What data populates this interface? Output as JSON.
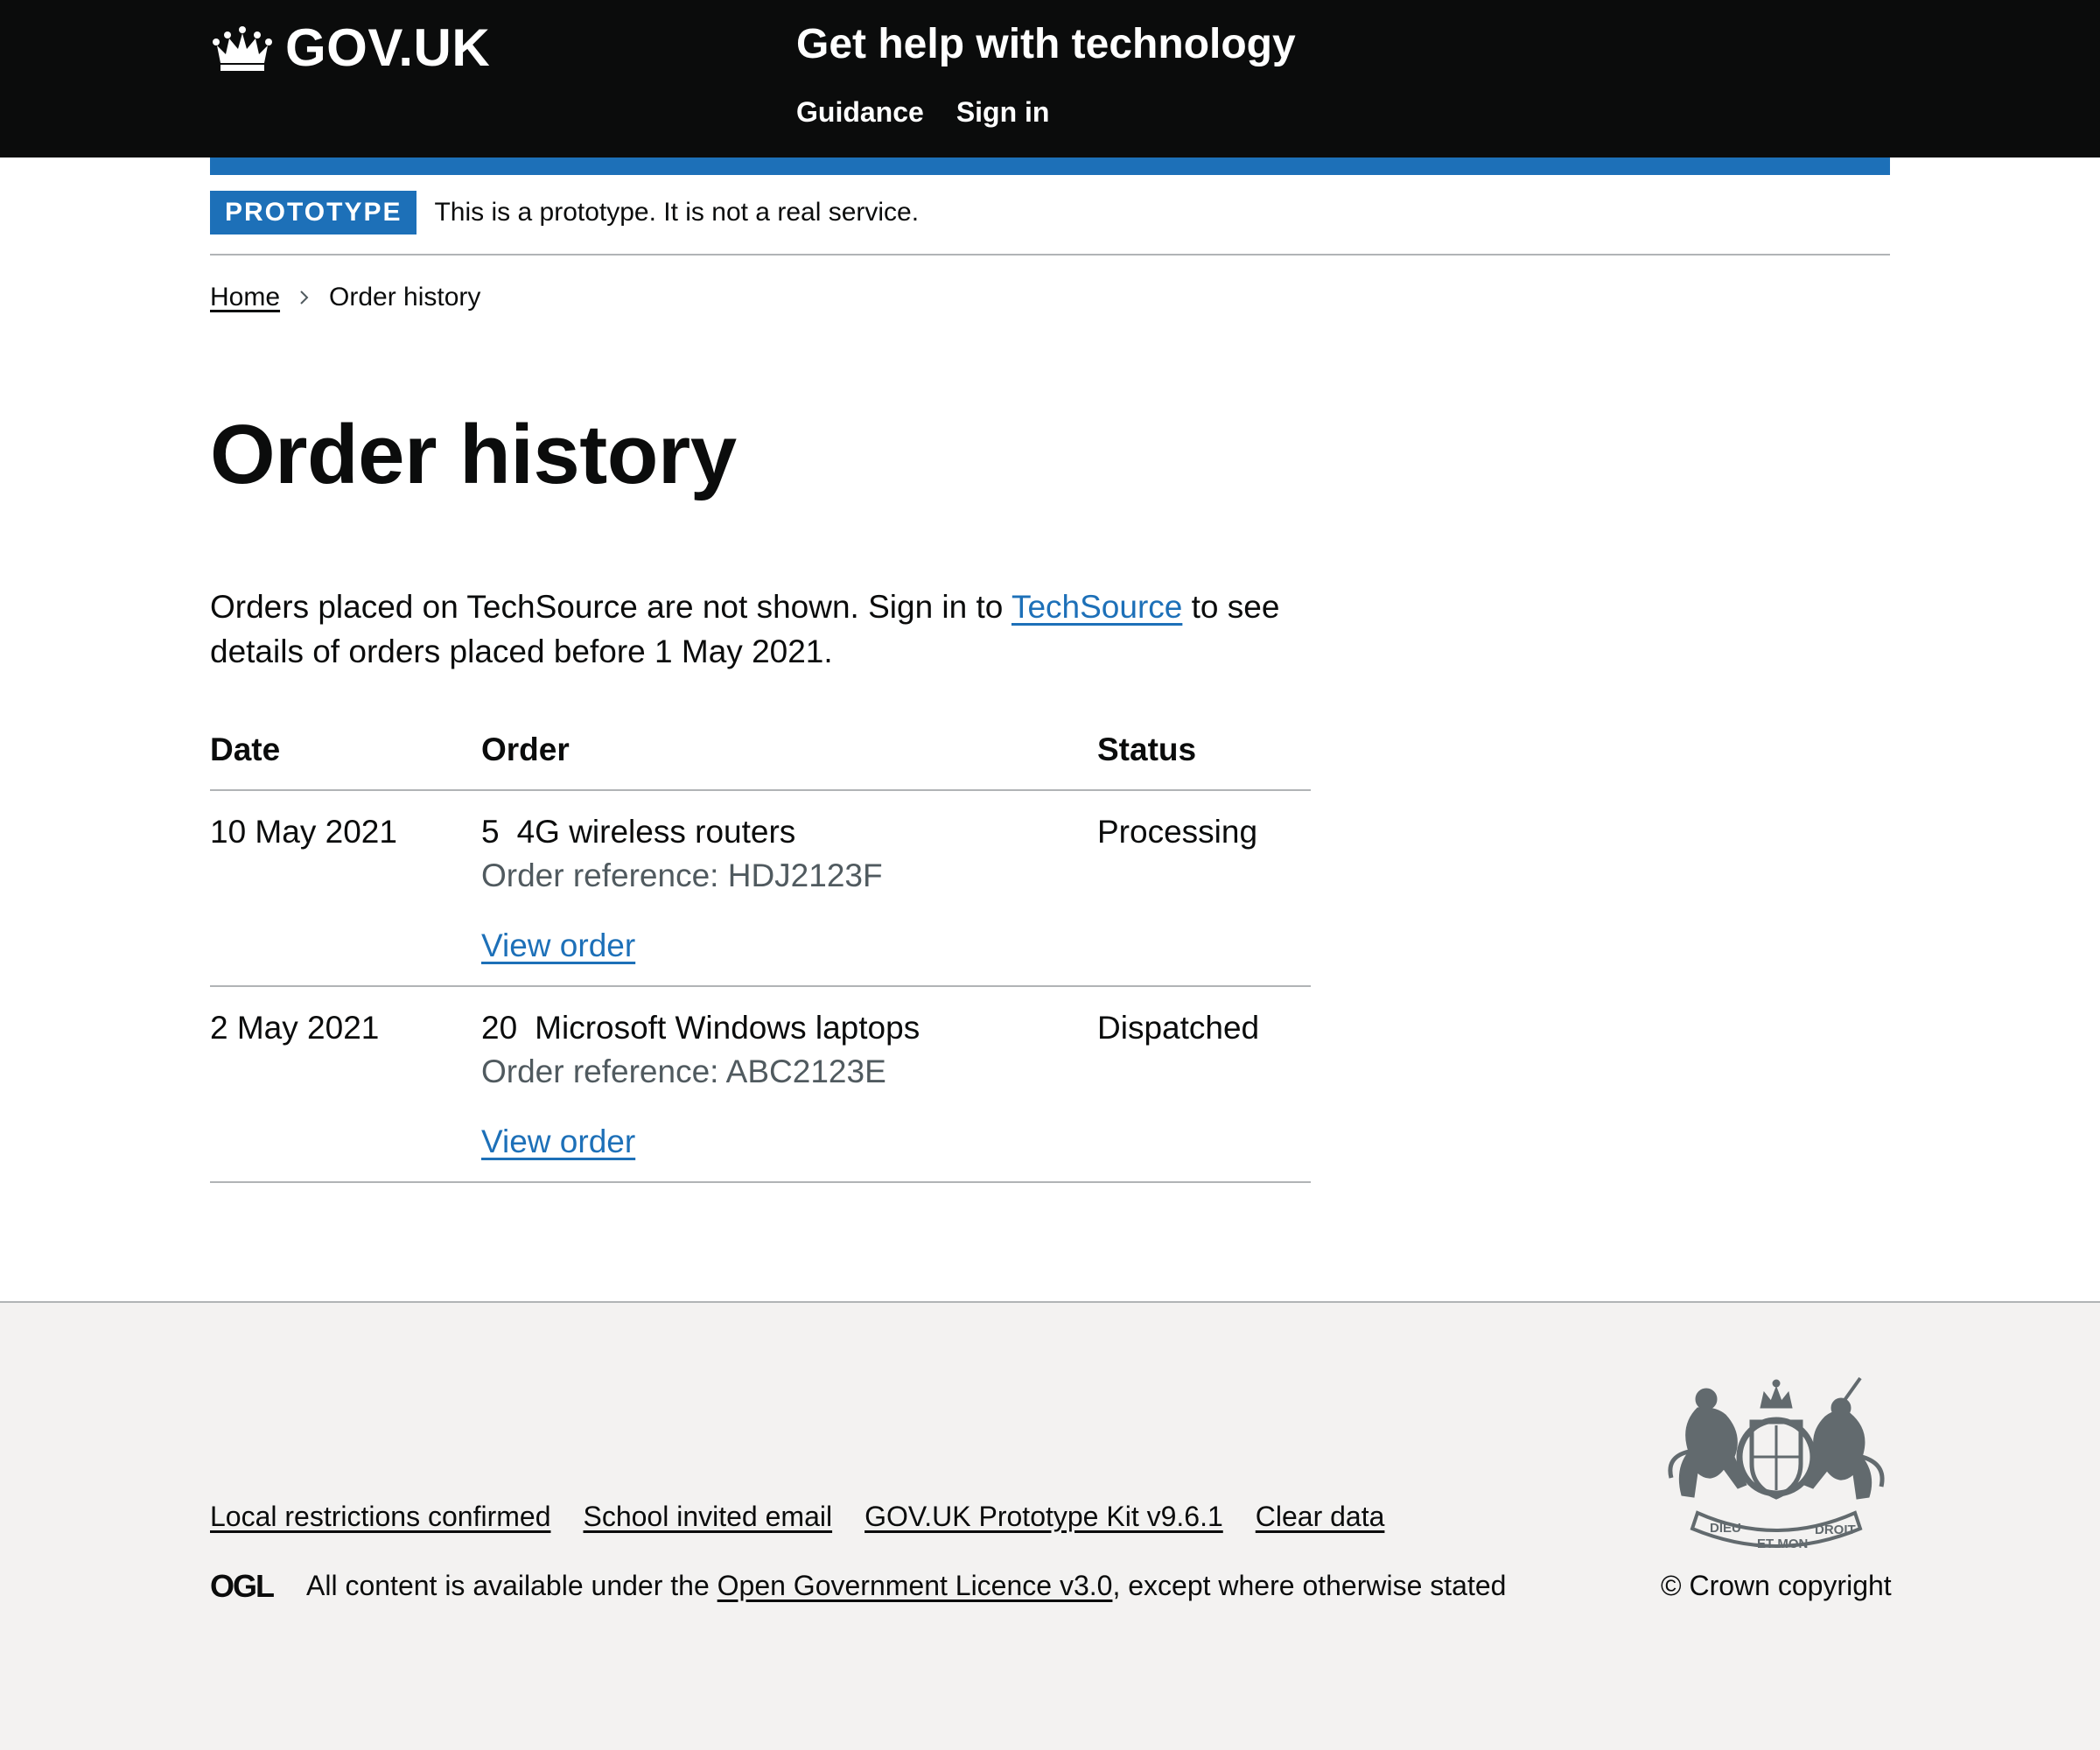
{
  "header": {
    "logo_text": "GOV.UK",
    "service_name": "Get help with technology",
    "nav": [
      {
        "label": "Guidance"
      },
      {
        "label": "Sign in"
      }
    ]
  },
  "phase_banner": {
    "tag": "PROTOTYPE",
    "text": "This is a prototype. It is not a real service."
  },
  "breadcrumb": [
    {
      "label": "Home"
    },
    {
      "label": "Order history"
    }
  ],
  "main": {
    "title": "Order history",
    "intro_before": "Orders placed on TechSource are not shown. Sign in to ",
    "intro_link": "TechSource",
    "intro_after": " to see details of orders placed before 1 May 2021.",
    "table": {
      "headers": [
        "Date",
        "Order",
        "Status"
      ],
      "rows": [
        {
          "date": "10 May 2021",
          "quantity": "5",
          "item": "4G wireless routers",
          "reference": "Order reference: HDJ2123F",
          "link": "View order",
          "status": "Processing"
        },
        {
          "date": "2 May 2021",
          "quantity": "20",
          "item": "Microsoft Windows laptops",
          "reference": "Order reference: ABC2123E",
          "link": "View order",
          "status": "Dispatched"
        }
      ]
    }
  },
  "footer": {
    "links": [
      {
        "label": "Local restrictions confirmed"
      },
      {
        "label": "School invited email"
      },
      {
        "label": "GOV.UK Prototype Kit v9.6.1"
      },
      {
        "label": "Clear data"
      }
    ],
    "licence_before": "All content is available under the ",
    "licence_link": "Open Government Licence v3.0",
    "licence_after": ", except where otherwise stated",
    "ogl_logo_text": "OGL",
    "copyright": "© Crown copyright",
    "crest_motto": [
      "DIEU",
      "ET MON",
      "DROIT"
    ]
  },
  "colors": {
    "header_bg": "#0b0c0c",
    "brand_blue": "#1d70b8",
    "link": "#1d70b8",
    "secondary_text": "#505a5f",
    "border": "#b1b4b6",
    "footer_bg": "#f3f2f1"
  }
}
